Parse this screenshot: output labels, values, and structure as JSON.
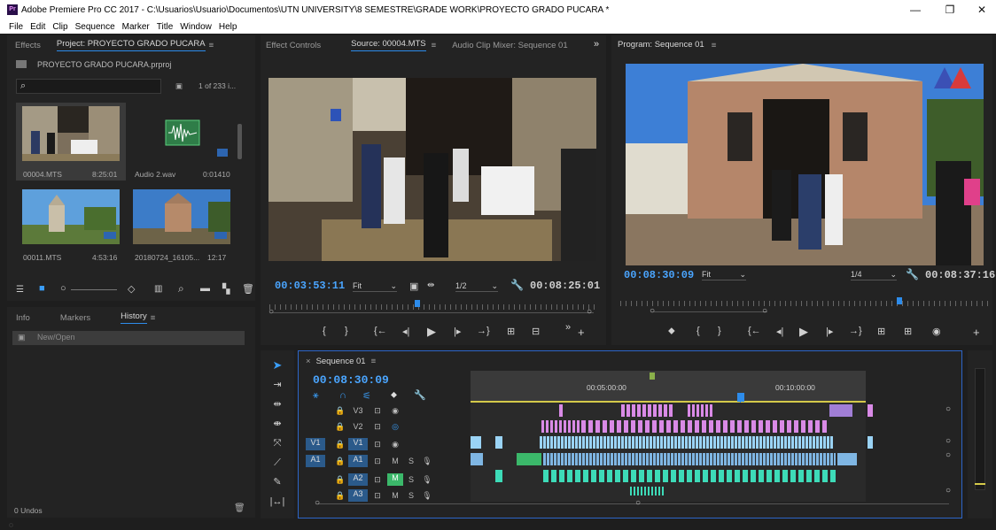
{
  "window": {
    "app_icon": "Pr",
    "title": "Adobe Premiere Pro CC 2017 - C:\\Usuarios\\Usuario\\Documentos\\UTN UNIVERSITY\\8 SEMESTRE\\GRADE WORK\\PROYECTO GRADO PUCARA *",
    "minimize": "—",
    "restore": "❐",
    "close": "✕"
  },
  "menu": [
    "File",
    "Edit",
    "Clip",
    "Sequence",
    "Marker",
    "Title",
    "Window",
    "Help"
  ],
  "project_panel": {
    "tabs": [
      "Effects",
      "Project: PROYECTO GRADO PUCARA"
    ],
    "menu_glyph": "≡",
    "file_name": "PROYECTO GRADO PUCARA.prproj",
    "search_placeholder": "",
    "item_count": "1 of 233 i...",
    "items": [
      {
        "name": "00004.MTS",
        "duration": "8:25:01"
      },
      {
        "name": "Audio 2.wav",
        "duration": "0:01410"
      },
      {
        "name": "00011.MTS",
        "duration": "4:53:16"
      },
      {
        "name": "20180724_16105...",
        "duration": "12:17"
      }
    ]
  },
  "history_panel": {
    "tabs": [
      "Info",
      "Markers",
      "History"
    ],
    "menu_glyph": "≡",
    "entries": [
      "New/Open"
    ],
    "undos": "0 Undos"
  },
  "source_monitor": {
    "tabs": [
      "Effect Controls",
      "Source: 00004.MTS",
      "Audio Clip Mixer: Sequence 01"
    ],
    "menu_glyph": "≡",
    "overflow": "»",
    "timecode": "00:03:53:11",
    "fit": "Fit",
    "resolution": "1/2",
    "duration": "00:08:25:01"
  },
  "program_monitor": {
    "tab": "Program: Sequence 01",
    "menu_glyph": "≡",
    "timecode": "00:08:30:09",
    "fit": "Fit",
    "resolution": "1/4",
    "duration": "00:08:37:16"
  },
  "timeline": {
    "tab": "Sequence 01",
    "close": "×",
    "menu_glyph": "≡",
    "timecode": "00:08:30:09",
    "ruler_marks": [
      "00:05:00:00",
      "00:10:00:00"
    ],
    "tracks": [
      {
        "patch": "",
        "name": "V3",
        "type": "video"
      },
      {
        "patch": "",
        "name": "V2",
        "type": "video"
      },
      {
        "patch": "V1",
        "name": "V1",
        "type": "video"
      },
      {
        "patch": "A1",
        "name": "A1",
        "type": "audio"
      },
      {
        "patch": "",
        "name": "A2",
        "type": "audio"
      },
      {
        "patch": "",
        "name": "A3",
        "type": "audio"
      }
    ],
    "mute_label": "M",
    "solo_label": "S"
  },
  "colors": {
    "accent": "#2d8ceb",
    "video_clip": "#9ad3f5",
    "pink_clip": "#d98ae6",
    "audio_clip": "#3ddbb8"
  }
}
